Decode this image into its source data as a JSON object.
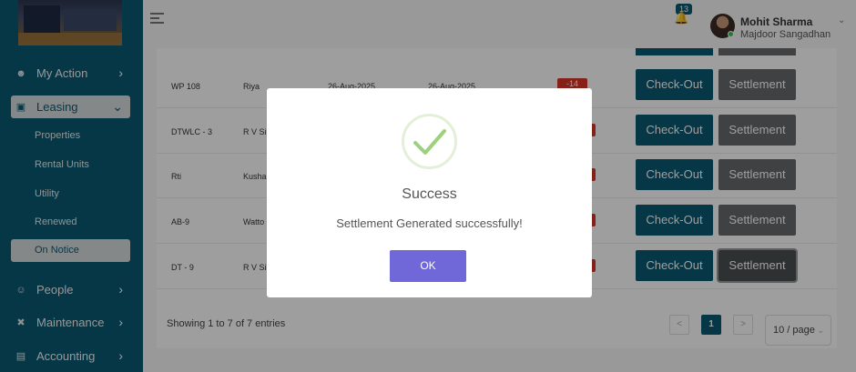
{
  "sidebar": {
    "items": [
      {
        "label": "My Action",
        "icon": "person-icon"
      },
      {
        "label": "Leasing",
        "icon": "lock-icon"
      },
      {
        "label": "People",
        "icon": "people-icon"
      },
      {
        "label": "Maintenance",
        "icon": "tools-icon"
      },
      {
        "label": "Accounting",
        "icon": "ledger-icon"
      }
    ],
    "sub_items": [
      "Properties",
      "Rental Units",
      "Utility",
      "Renewed",
      "On Notice"
    ]
  },
  "header": {
    "notification_count": "13",
    "user_name": "Mohit Sharma",
    "user_org": "Majdoor Sangadhan"
  },
  "table": {
    "rows": [
      {
        "unit": "WP 108",
        "tenant": "Riya",
        "start": "26-Aug-2025",
        "end": "26-Aug-2025",
        "days": "-14"
      },
      {
        "unit": "DTWLC - 3",
        "tenant": "R V Sin",
        "start": "",
        "end": "",
        "days": ""
      },
      {
        "unit": "Rti",
        "tenant": "Kusha",
        "start": "",
        "end": "",
        "days": ""
      },
      {
        "unit": "AB-9",
        "tenant": "Watto",
        "start": "",
        "end": "",
        "days": ""
      },
      {
        "unit": "DT - 9",
        "tenant": "R V Sin",
        "start": "",
        "end": "",
        "days": ""
      }
    ],
    "checkout_label": "Check-Out",
    "settlement_label": "Settlement"
  },
  "pagination": {
    "showing": "Showing 1 to 7 of 7 entries",
    "prev": "<",
    "page": "1",
    "next": ">",
    "per_page": "10 / page"
  },
  "modal": {
    "title": "Success",
    "message": "Settlement Generated successfully!",
    "ok_label": "OK",
    "icon": "checkmark-icon",
    "accent": "#7067d8"
  },
  "colors": {
    "primary": "#0b5a72",
    "danger": "#d9362b",
    "secondary": "#666a6c"
  }
}
